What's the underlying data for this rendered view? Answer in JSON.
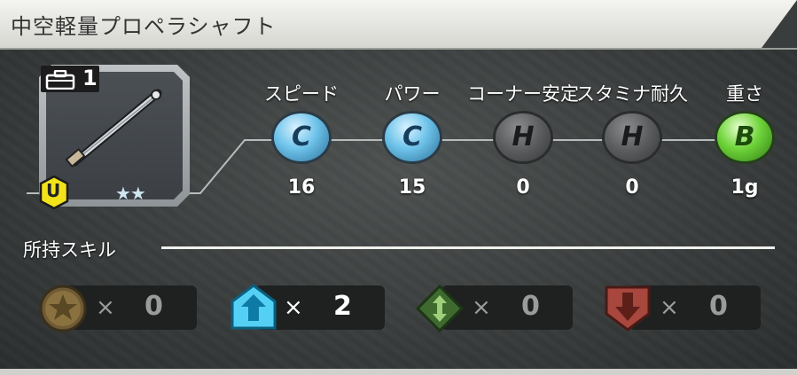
{
  "header": {
    "title": "中空軽量プロペラシャフト"
  },
  "item": {
    "count": "1",
    "rank": "U",
    "stars": "★★",
    "icon": "propeller-shaft-icon"
  },
  "stats": [
    {
      "label": "スピード",
      "grade": "C",
      "value": "16",
      "grade_color": "#6ec3ea"
    },
    {
      "label": "パワー",
      "grade": "C",
      "value": "15",
      "grade_color": "#6ec3ea"
    },
    {
      "label": "コーナー安定",
      "grade": "H",
      "value": "0",
      "grade_color": "#5a5c5e"
    },
    {
      "label": "スタミナ耐久",
      "grade": "H",
      "value": "0",
      "grade_color": "#5a5c5e"
    },
    {
      "label": "重さ",
      "grade": "B",
      "value": "1g",
      "grade_color": "#6fd43a"
    }
  ],
  "skills": {
    "label": "所持スキル",
    "items": [
      {
        "icon": "star-medal-icon",
        "times": "×",
        "count": "0",
        "active": false
      },
      {
        "icon": "up-arrow-icon",
        "times": "×",
        "count": "2",
        "active": true
      },
      {
        "icon": "up-down-arrow-icon",
        "times": "×",
        "count": "0",
        "active": false
      },
      {
        "icon": "down-arrow-icon",
        "times": "×",
        "count": "0",
        "active": false
      }
    ]
  }
}
